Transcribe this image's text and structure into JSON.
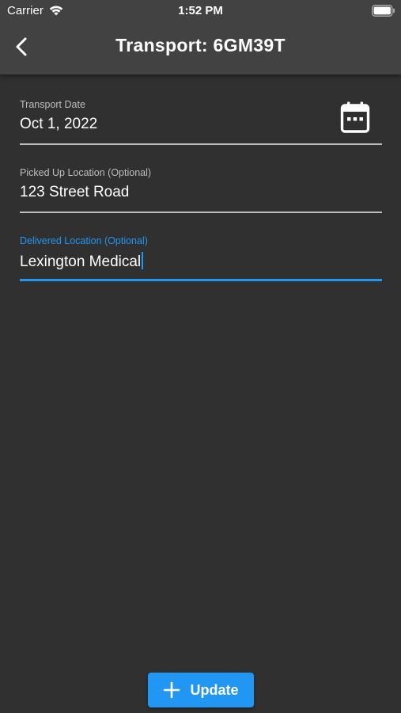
{
  "status_bar": {
    "carrier": "Carrier",
    "time": "1:52 PM",
    "icons": [
      "wifi-icon",
      "battery-icon"
    ]
  },
  "app_bar": {
    "title": "Transport: 6GM39T",
    "back_icon": "chevron-left-icon"
  },
  "form": {
    "transport_date": {
      "label": "Transport Date",
      "value": "Oct 1, 2022",
      "icon": "calendar-icon"
    },
    "picked_up_location": {
      "label": "Picked Up Location (Optional)",
      "value": "123 Street Road"
    },
    "delivered_location": {
      "label": "Delivered Location (Optional)",
      "value": "Lexington Medical",
      "focused": true
    }
  },
  "actions": {
    "update_label": "Update",
    "update_icon": "plus-icon"
  },
  "colors": {
    "background": "#303030",
    "app_bar": "#424242",
    "accent": "#2196f3",
    "label": "#bdbdbd",
    "text": "#ffffff"
  }
}
